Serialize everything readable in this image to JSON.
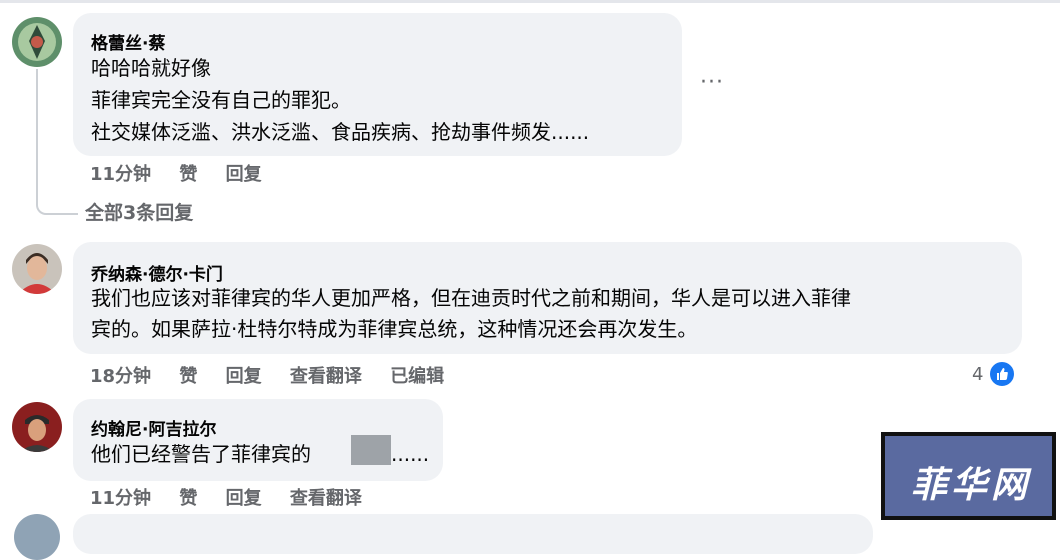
{
  "comments": [
    {
      "author": "格蕾丝·蔡",
      "lines": [
        "哈哈哈就好像",
        "菲律宾完全没有自己的罪犯。",
        "社交媒体泛滥、洪水泛滥、食品疾病、抢劫事件频发......"
      ],
      "time": "11分钟",
      "like": "赞",
      "reply": "回复",
      "view_replies": "全部3条回复",
      "more": "···"
    },
    {
      "author": "乔纳森·德尔·卡门",
      "lines": [
        "我们也应该对菲律宾的华人更加严格，但在迪贡时代之前和期间，华人是可以进入菲律",
        "宾的。如果萨拉·杜特尔特成为菲律宾总统，这种情况还会再次发生。"
      ],
      "time": "18分钟",
      "like": "赞",
      "reply": "回复",
      "translate": "查看翻译",
      "edited": "已编辑",
      "reaction_count": "4"
    },
    {
      "author": "约翰尼·阿吉拉尔",
      "line_before": "他们已经警告了菲律宾的",
      "line_after": "......",
      "time": "11分钟",
      "like": "赞",
      "reply": "回复",
      "translate": "查看翻译"
    }
  ],
  "watermark": "菲华网",
  "icons": {
    "like_badge": "thumbs-up-icon",
    "more": "more-options-icon"
  },
  "colors": {
    "bubble": "#f0f2f5",
    "meta_text": "#65676b",
    "like_blue": "#1877f2",
    "watermark_bg": "#5a6aa0"
  }
}
